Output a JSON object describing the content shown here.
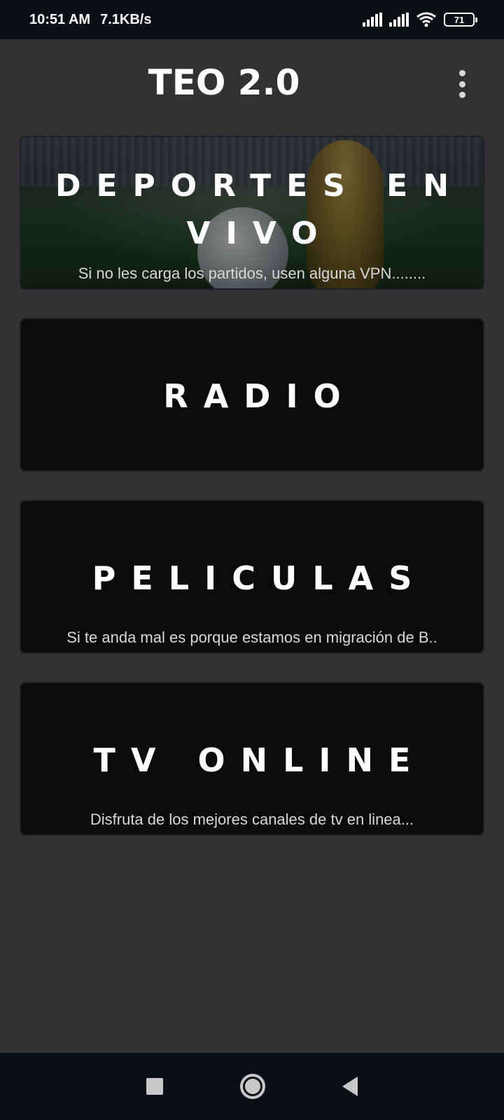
{
  "status_bar": {
    "time": "10:51 AM",
    "speed": "7.1KB/s",
    "battery": "71"
  },
  "app_bar": {
    "title": "TEO 2.0"
  },
  "cards": [
    {
      "title": "DEPORTES EN VIVO",
      "subtitle": "Si no les carga los partidos, usen alguna  VPN........"
    },
    {
      "title": "RADIO",
      "subtitle": ""
    },
    {
      "title": "PELICULAS",
      "subtitle": "Si te anda mal es porque estamos en migración de B.."
    },
    {
      "title": "TV ONLINE",
      "subtitle": "Disfruta de los mejores canales de tv en linea..."
    }
  ],
  "colors": {
    "background": "#333132",
    "card": "#0b0b0b",
    "system_bar": "#0b0f14"
  }
}
